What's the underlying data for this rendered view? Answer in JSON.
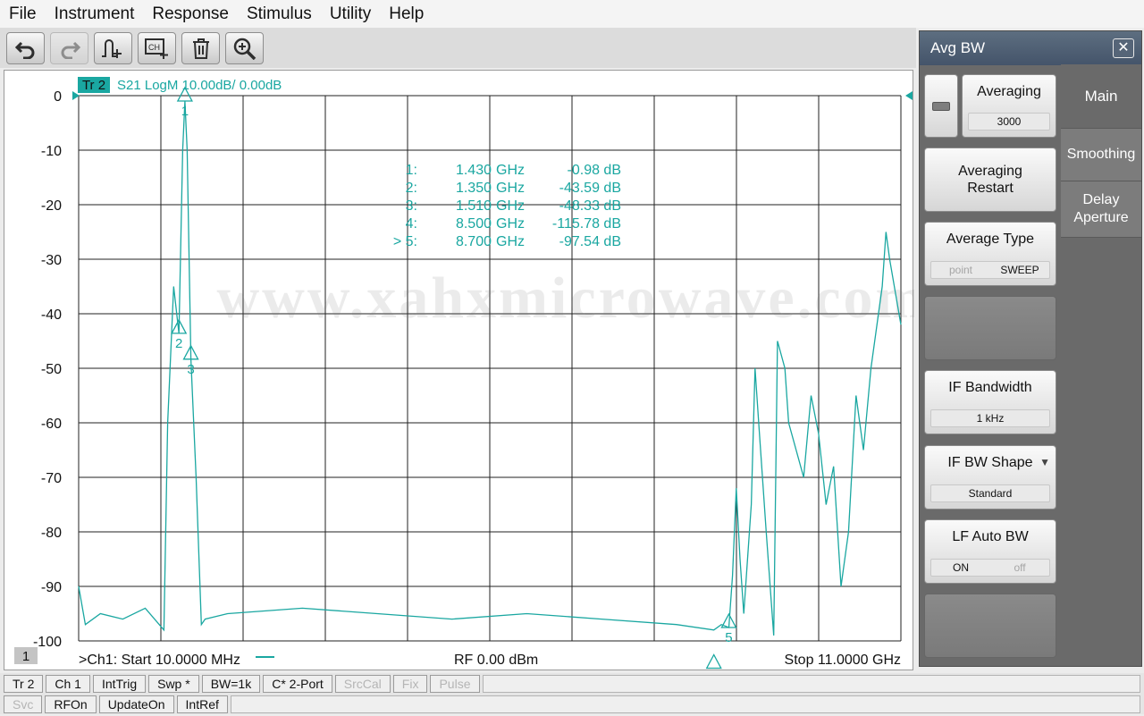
{
  "menu": [
    "File",
    "Instrument",
    "Response",
    "Stimulus",
    "Utility",
    "Help"
  ],
  "toolbar": {
    "buttons": [
      {
        "icon": "undo-icon",
        "enabled": true
      },
      {
        "icon": "redo-icon",
        "enabled": false
      },
      {
        "icon": "add-marker-icon",
        "enabled": true
      },
      {
        "icon": "new-channel-icon",
        "enabled": true
      },
      {
        "icon": "trash-icon",
        "enabled": true
      },
      {
        "icon": "zoom-icon",
        "enabled": true
      }
    ]
  },
  "trace": {
    "badge": "Tr 2",
    "header": "S21 LogM 10.00dB/  0.00dB",
    "color": "#1aa7a1"
  },
  "window_number": "1",
  "watermark": "www.xahxmicrowave.com",
  "plot_footer": {
    "start": ">Ch1:  Start   10.0000 MHz",
    "rf": "RF     0.00 dBm",
    "stop": "Stop  11.0000 GHz"
  },
  "markers": [
    {
      "index": "1:",
      "freq": "1.430",
      "unit": "GHz",
      "value": "-0.98 dB"
    },
    {
      "index": "2:",
      "freq": "1.350",
      "unit": "GHz",
      "value": "-43.59 dB"
    },
    {
      "index": "3:",
      "freq": "1.510",
      "unit": "GHz",
      "value": "-48.33 dB"
    },
    {
      "index": "4:",
      "freq": "8.500",
      "unit": "GHz",
      "value": "-115.78 dB"
    },
    {
      "index": "> 5:",
      "freq": "8.700",
      "unit": "GHz",
      "value": "-97.54 dB"
    }
  ],
  "chart_data": {
    "type": "line",
    "title": "",
    "xlabel": "",
    "ylabel": "",
    "x_unit": "GHz",
    "xlim": [
      0.01,
      11.0
    ],
    "ylim": [
      -100,
      0
    ],
    "ytick_labels": [
      "0",
      "-10",
      "-20",
      "-30",
      "-40",
      "-50",
      "-60",
      "-70",
      "-80",
      "-90",
      "-100"
    ],
    "grid": true,
    "series": [
      {
        "x": [
          0.01,
          0.1,
          0.3,
          0.6,
          0.9,
          1.15,
          1.2,
          1.28,
          1.35,
          1.4,
          1.43,
          1.46,
          1.51,
          1.58,
          1.65,
          1.7,
          2.0,
          3.0,
          4.0,
          5.0,
          6.0,
          7.0,
          8.0,
          8.5,
          8.6,
          8.7,
          8.75,
          8.8,
          8.85,
          8.9,
          9.0,
          9.05,
          9.1,
          9.2,
          9.3,
          9.35,
          9.45,
          9.5,
          9.6,
          9.7,
          9.8,
          9.9,
          10.0,
          10.1,
          10.2,
          10.3,
          10.4,
          10.5,
          10.6,
          10.7,
          10.75,
          10.8,
          10.85,
          10.95,
          11.0
        ],
        "y": [
          -90,
          -97,
          -95,
          -96,
          -94,
          -98,
          -60,
          -35,
          -43.59,
          -10,
          -0.98,
          -10,
          -48.33,
          -70,
          -97,
          -96,
          -95,
          -94,
          -95,
          -96,
          -95,
          -96,
          -97,
          -98,
          -97,
          -97.54,
          -88,
          -72,
          -85,
          -95,
          -75,
          -50,
          -60,
          -80,
          -99,
          -45,
          -50,
          -60,
          -65,
          -70,
          -55,
          -62,
          -75,
          -68,
          -90,
          -80,
          -55,
          -65,
          -50,
          -40,
          -35,
          -25,
          -30,
          -38,
          -42
        ]
      }
    ],
    "marker_points": [
      {
        "label": "1",
        "x": 1.43,
        "y": -0.98
      },
      {
        "label": "2",
        "x": 1.35,
        "y": -43.59
      },
      {
        "label": "3",
        "x": 1.51,
        "y": -48.33
      },
      {
        "label": "4",
        "x": 8.5,
        "y": -115.78
      },
      {
        "label": "5",
        "x": 8.7,
        "y": -97.54
      }
    ]
  },
  "panel": {
    "title": "Avg BW",
    "tabs": [
      "Main",
      "Smoothing",
      "Delay Aperture"
    ],
    "averaging": {
      "label": "Averaging",
      "value": "3000"
    },
    "averaging_restart": "Averaging Restart",
    "average_type": {
      "label": "Average Type",
      "options": [
        "point",
        "SWEEP"
      ],
      "selected": "SWEEP"
    },
    "if_bandwidth": {
      "label": "IF Bandwidth",
      "value": "1 kHz"
    },
    "if_bw_shape": {
      "label": "IF BW Shape",
      "value": "Standard"
    },
    "lf_auto_bw": {
      "label": "LF Auto BW",
      "options": [
        "ON",
        "off"
      ],
      "selected": "ON"
    }
  },
  "status_row1": [
    "Tr 2",
    "Ch 1",
    "IntTrig",
    "Swp *",
    "BW=1k",
    "C* 2-Port",
    "SrcCal",
    "Fix",
    "Pulse"
  ],
  "status_row1_dim": [
    false,
    false,
    false,
    false,
    false,
    false,
    true,
    true,
    true
  ],
  "status_row2": [
    "Svc",
    "RFOn",
    "UpdateOn",
    "IntRef"
  ],
  "status_row2_dim": [
    true,
    false,
    false,
    false
  ]
}
